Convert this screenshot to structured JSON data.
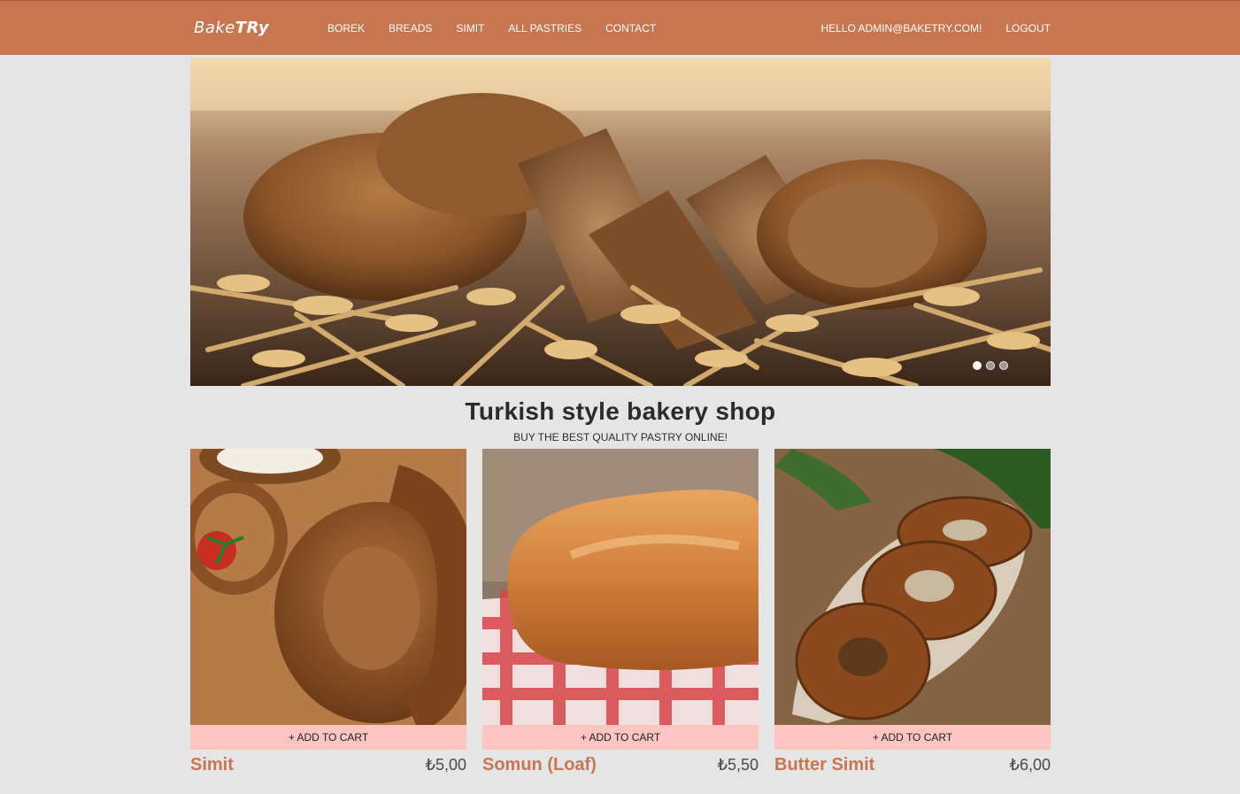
{
  "nav": {
    "brand_light": "Bake",
    "brand_bold": "TRy",
    "links": [
      "BOREK",
      "BREADS",
      "SIMIT",
      "ALL PASTRIES",
      "CONTACT"
    ],
    "greeting": "HELLO ADMIN@BAKETRY.COM!",
    "logout": "LOGOUT"
  },
  "hero": {
    "slide_count": 3,
    "active_slide": 1
  },
  "headline": {
    "title": "Turkish style bakery shop",
    "subtitle": "BUY THE BEST QUALITY PASTRY ONLINE!"
  },
  "products": [
    {
      "name": "Simit",
      "price": "₺5,00",
      "cart_label": "+ ADD TO CART"
    },
    {
      "name": "Somun (Loaf)",
      "price": "₺5,50",
      "cart_label": "+ ADD TO CART"
    },
    {
      "name": "Butter Simit",
      "price": "₺6,00",
      "cart_label": "+ ADD TO CART"
    }
  ],
  "colors": {
    "nav_bg": "#c87650",
    "page_bg": "#e5e5e5",
    "cart_bg": "#fdc5bf",
    "product_name": "#c87650"
  }
}
